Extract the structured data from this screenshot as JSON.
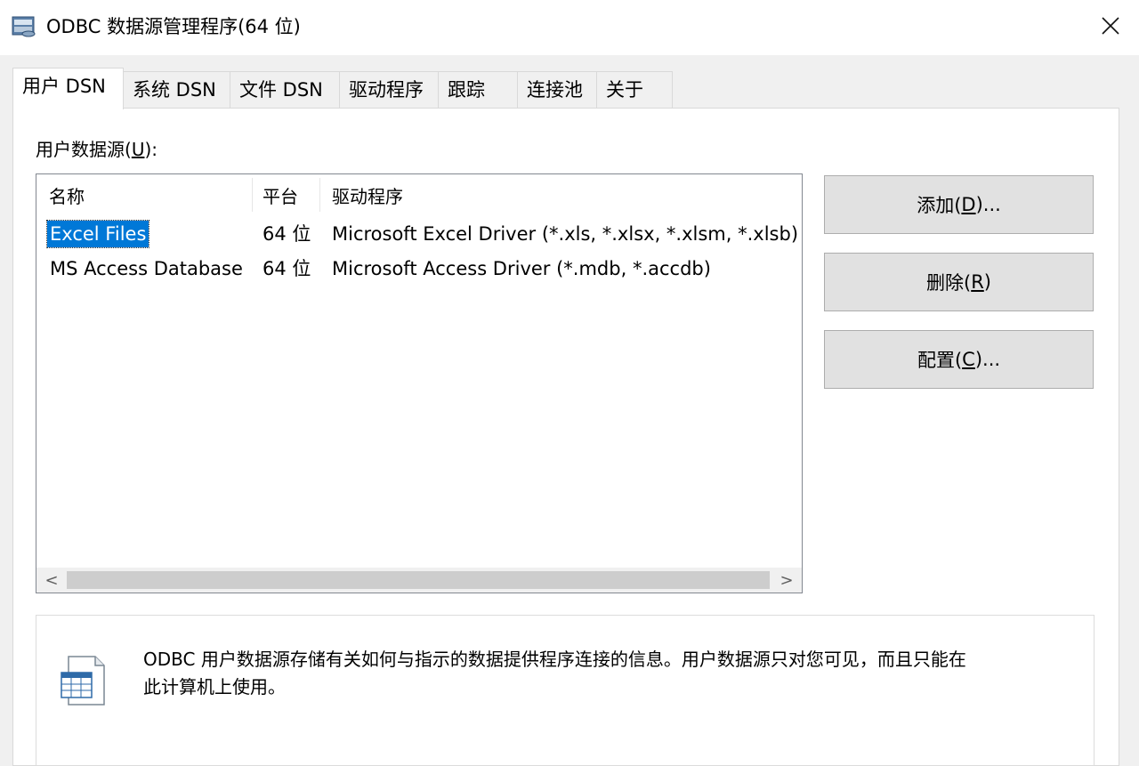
{
  "window": {
    "title": "ODBC 数据源管理程序(64 位)",
    "close_label": "✕"
  },
  "tabs": [
    {
      "label": "用户 DSN",
      "active": true
    },
    {
      "label": "系统 DSN",
      "active": false
    },
    {
      "label": "文件 DSN",
      "active": false
    },
    {
      "label": "驱动程序",
      "active": false
    },
    {
      "label": "跟踪",
      "active": false
    },
    {
      "label": "连接池",
      "active": false
    },
    {
      "label": "关于",
      "active": false
    }
  ],
  "user_dsn": {
    "section_label_prefix": "用户数据源(",
    "section_label_key": "U",
    "section_label_suffix": "):",
    "columns": [
      "名称",
      "平台",
      "驱动程序"
    ],
    "rows": [
      {
        "name": "Excel Files",
        "platform": "64 位",
        "driver": "Microsoft Excel Driver (*.xls, *.xlsx, *.xlsm, *.xlsb)",
        "selected": true
      },
      {
        "name": "MS Access Database",
        "platform": "64 位",
        "driver": "Microsoft Access Driver (*.mdb, *.accdb)",
        "selected": false
      }
    ],
    "scroll_left": "<",
    "scroll_right": ">"
  },
  "buttons": {
    "add": {
      "prefix": "添加(",
      "key": "D",
      "suffix": ")..."
    },
    "remove": {
      "prefix": "删除(",
      "key": "R",
      "suffix": ")"
    },
    "configure": {
      "prefix": "配置(",
      "key": "C",
      "suffix": ")..."
    }
  },
  "info": {
    "line1": "ODBC 用户数据源存储有关如何与指示的数据提供程序连接的信息。用户数据源只对您可见，而且只能在",
    "line2": "此计算机上使用。"
  },
  "icons": {
    "app": "odbc-app-icon",
    "close": "close-icon",
    "info": "datasource-document-icon"
  },
  "colors": {
    "selection": "#0078d7",
    "button_face": "#e1e1e1",
    "window_bg": "#f0f0f0"
  }
}
